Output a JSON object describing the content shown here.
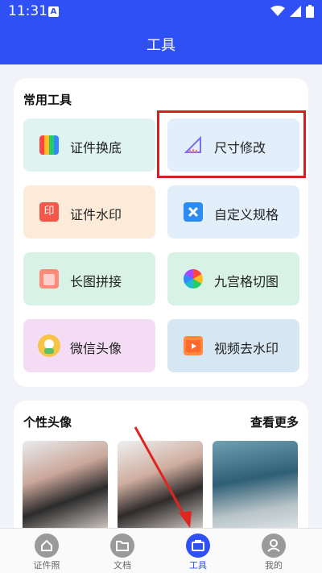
{
  "status": {
    "time": "11:31"
  },
  "appbar": {
    "title": "工具"
  },
  "tools_section": {
    "title": "常用工具",
    "items": [
      {
        "label": "证件换底",
        "icon": "color-grid-icon"
      },
      {
        "label": "尺寸修改",
        "icon": "ruler-icon"
      },
      {
        "label": "证件水印",
        "icon": "stamp-icon"
      },
      {
        "label": "自定义规格",
        "icon": "custom-x-icon"
      },
      {
        "label": "长图拼接",
        "icon": "splice-icon"
      },
      {
        "label": "九宫格切图",
        "icon": "aperture-icon"
      },
      {
        "label": "微信头像",
        "icon": "wechat-avatar-icon"
      },
      {
        "label": "视频去水印",
        "icon": "video-icon"
      }
    ]
  },
  "avatar_section": {
    "title": "个性头像",
    "more": "查看更多"
  },
  "tabbar": {
    "items": [
      {
        "label": "证件照"
      },
      {
        "label": "文档"
      },
      {
        "label": "工具"
      },
      {
        "label": "我的"
      }
    ]
  }
}
